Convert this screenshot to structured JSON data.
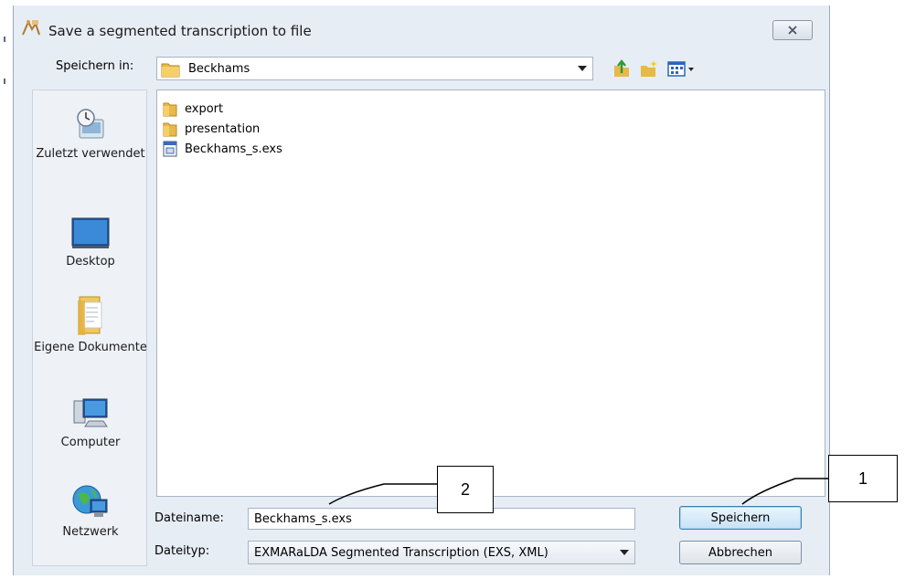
{
  "dialog": {
    "title": "Save a segmented transcription to file"
  },
  "toolbar": {
    "save_in_label": "Speichern in:",
    "current_folder": "Beckhams"
  },
  "places": [
    {
      "label": "Zuletzt verwendet"
    },
    {
      "label": "Desktop"
    },
    {
      "label": "Eigene Dokumente"
    },
    {
      "label": "Computer"
    },
    {
      "label": "Netzwerk"
    }
  ],
  "files": [
    {
      "name": "export",
      "type": "folder"
    },
    {
      "name": "presentation",
      "type": "folder"
    },
    {
      "name": "Beckhams_s.exs",
      "type": "file"
    }
  ],
  "form": {
    "filename_label": "Dateiname:",
    "filename_value": "Beckhams_s.exs",
    "filetype_label": "Dateityp:",
    "filetype_value": "EXMARaLDA Segmented Transcription (EXS, XML)"
  },
  "buttons": {
    "save": "Speichern",
    "cancel": "Abbrechen"
  },
  "callouts": {
    "one": "1",
    "two": "2"
  }
}
